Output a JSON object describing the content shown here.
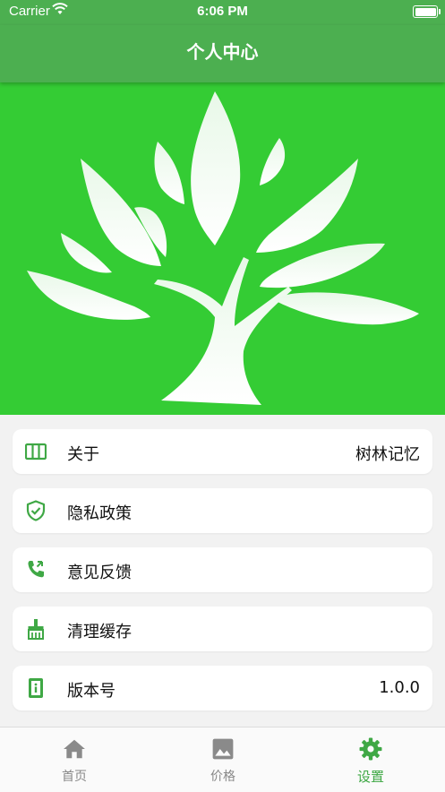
{
  "status_bar": {
    "carrier": "Carrier",
    "time": "6:06 PM"
  },
  "nav": {
    "title": "个人中心"
  },
  "theme": {
    "primary": "#4caf50",
    "hero_bg": "#34cc34",
    "icon_green": "#3fa845"
  },
  "menu": [
    {
      "label": "关于",
      "value": "树林记忆",
      "icon": "columns-icon"
    },
    {
      "label": "隐私政策",
      "value": "",
      "icon": "shield-check-icon"
    },
    {
      "label": "意见反馈",
      "value": "",
      "icon": "phone-forward-icon"
    },
    {
      "label": "清理缓存",
      "value": "",
      "icon": "broom-icon"
    },
    {
      "label": "版本号",
      "value": "1.0.0",
      "icon": "device-info-icon"
    }
  ],
  "tabs": [
    {
      "label": "首页",
      "icon": "home-icon",
      "active": false
    },
    {
      "label": "价格",
      "icon": "image-icon",
      "active": false
    },
    {
      "label": "设置",
      "icon": "gear-icon",
      "active": true
    }
  ]
}
